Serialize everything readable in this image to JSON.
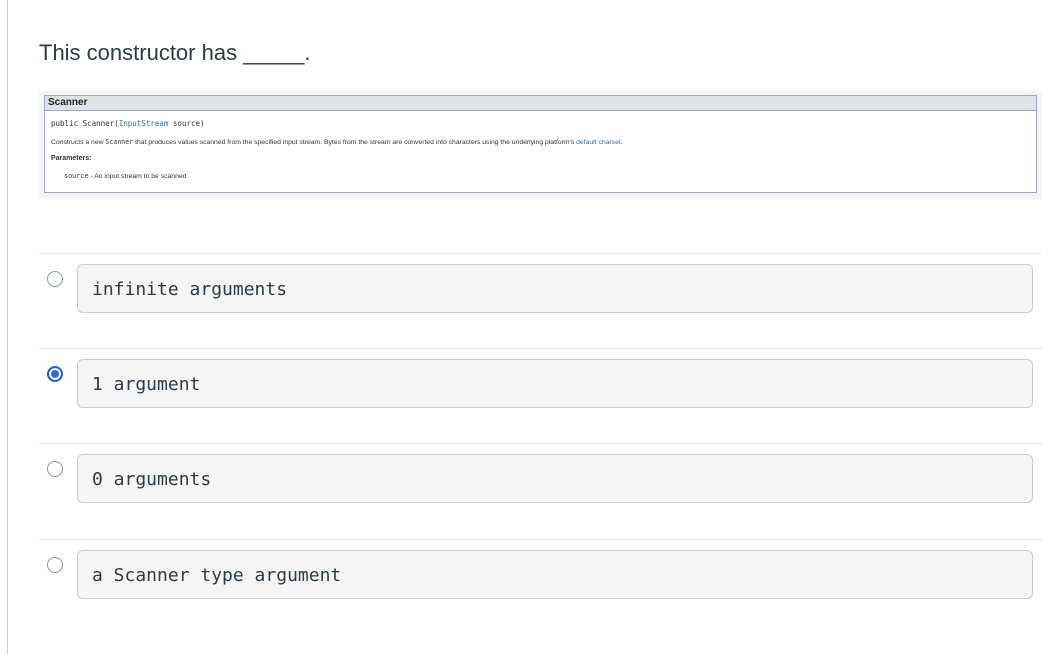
{
  "question": {
    "text": "This constructor has _____."
  },
  "doc": {
    "header": "Scanner",
    "signature_prefix": "public Scanner(",
    "signature_type": "InputStream",
    "signature_suffix": " source)",
    "desc_pre": "Constructs a new ",
    "desc_class": "Scanner",
    "desc_mid": " that produces values scanned from the specified input stream. Bytes from the stream are converted into characters using the underlying platform's ",
    "desc_link": "default charset",
    "desc_end": ".",
    "params_label": "Parameters:",
    "param_name": "source",
    "param_desc": " - An input stream to be scanned"
  },
  "answers": [
    {
      "label": "infinite arguments",
      "selected": false
    },
    {
      "label": "1 argument",
      "selected": true
    },
    {
      "label": "0 arguments",
      "selected": false
    },
    {
      "label": "a Scanner type argument",
      "selected": false
    }
  ]
}
